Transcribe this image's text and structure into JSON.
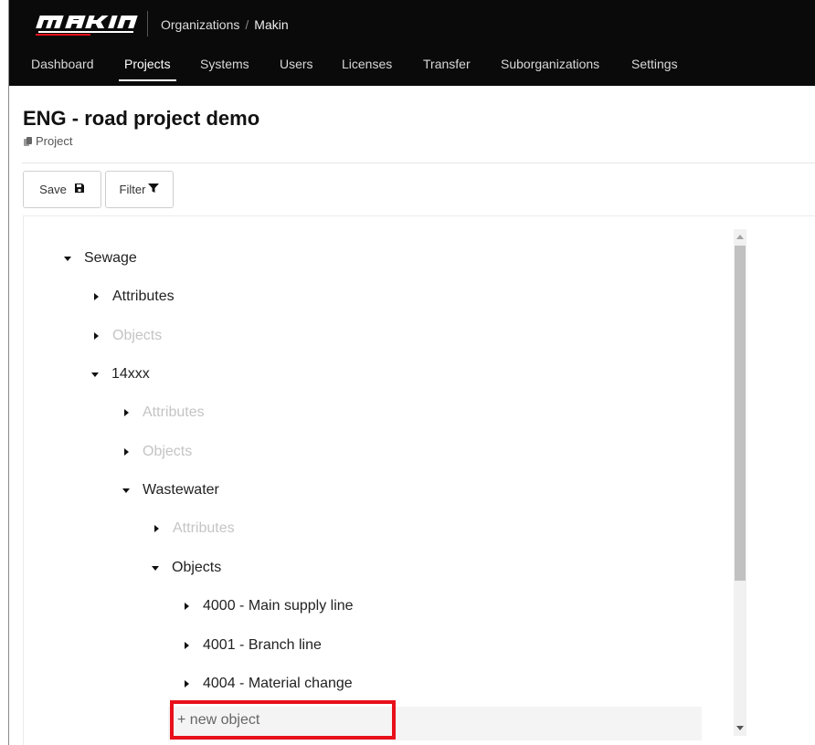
{
  "app": {
    "logo_text": "MAKIN",
    "breadcrumb": {
      "root": "Organizations",
      "separator": "/",
      "current": "Makin"
    }
  },
  "nav": {
    "items": [
      {
        "label": "Dashboard",
        "active": false
      },
      {
        "label": "Projects",
        "active": true
      },
      {
        "label": "Systems",
        "active": false
      },
      {
        "label": "Users",
        "active": false
      },
      {
        "label": "Licenses",
        "active": false
      },
      {
        "label": "Transfer",
        "active": false
      },
      {
        "label": "Suborganizations",
        "active": false
      },
      {
        "label": "Settings",
        "active": false
      }
    ]
  },
  "page": {
    "title": "ENG - road project demo",
    "subtitle": "Project",
    "subtitle_icon": "copy-icon"
  },
  "toolbar": {
    "save_label": "Save",
    "save_icon": "floppy-disk-icon",
    "filter_label": "Filter",
    "filter_icon": "funnel-icon"
  },
  "tree": {
    "nodes": [
      {
        "label": "Sewage",
        "expanded": true,
        "muted": false,
        "depth": 0
      },
      {
        "label": "Attributes",
        "expanded": false,
        "muted": false,
        "depth": 1
      },
      {
        "label": "Objects",
        "expanded": false,
        "muted": true,
        "depth": 1
      },
      {
        "label": "14xxx",
        "expanded": true,
        "muted": false,
        "depth": 1
      },
      {
        "label": "Attributes",
        "expanded": false,
        "muted": true,
        "depth": 2
      },
      {
        "label": "Objects",
        "expanded": false,
        "muted": true,
        "depth": 2
      },
      {
        "label": "Wastewater",
        "expanded": true,
        "muted": false,
        "depth": 2
      },
      {
        "label": "Attributes",
        "expanded": false,
        "muted": true,
        "depth": 3
      },
      {
        "label": "Objects",
        "expanded": true,
        "muted": false,
        "depth": 3
      },
      {
        "label": "4000 - Main supply line",
        "expanded": false,
        "muted": false,
        "depth": 4
      },
      {
        "label": "4001 - Branch line",
        "expanded": false,
        "muted": false,
        "depth": 4
      },
      {
        "label": "4004 - Material change",
        "expanded": false,
        "muted": false,
        "depth": 4
      }
    ],
    "new_object_label": "+ new object"
  },
  "colors": {
    "topbar": "#0a0a0a",
    "highlight_box": "#e8101a",
    "muted_text": "#c4c4c4"
  }
}
